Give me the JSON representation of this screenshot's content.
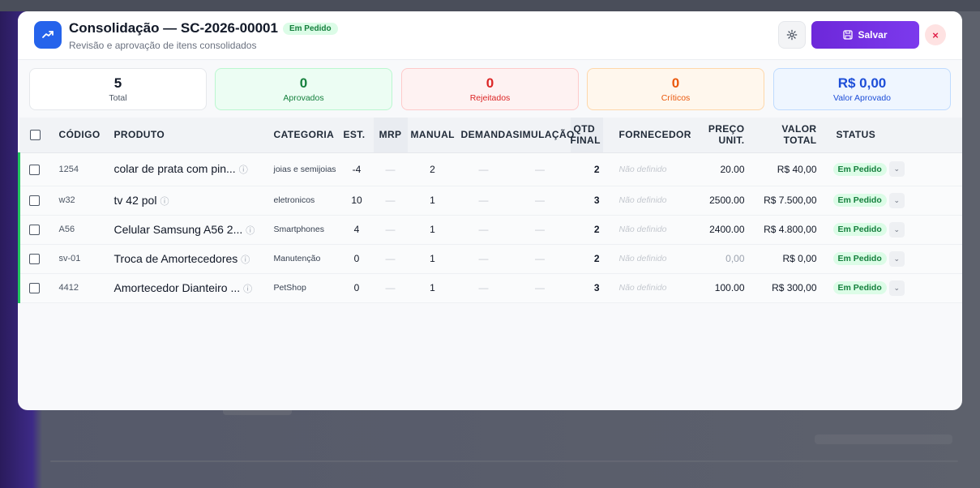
{
  "header": {
    "title": "Consolidação — SC-2026-00001",
    "status": "Em Pedido",
    "subtitle": "Revisão e aprovação de itens consolidados",
    "save_label": "Salvar",
    "close_label": "×"
  },
  "cards": [
    {
      "value": "5",
      "label": "Total"
    },
    {
      "value": "0",
      "label": "Aprovados"
    },
    {
      "value": "0",
      "label": "Rejeitados"
    },
    {
      "value": "0",
      "label": "Críticos"
    },
    {
      "value": "R$ 0,00",
      "label": "Valor Aprovado"
    }
  ],
  "columns": {
    "codigo": "CÓDIGO",
    "produto": "PRODUTO",
    "categoria": "CATEGORIA",
    "est": "EST.",
    "mrp": "MRP",
    "manual": "MANUAL",
    "demanda": "DEMANDA",
    "simulacao": "SIMULAÇÃO",
    "qtd_final_1": "QTD",
    "qtd_final_2": "FINAL",
    "fornecedor": "FORNECEDOR",
    "preco_1": "PREÇO",
    "preco_2": "UNIT.",
    "valor_1": "VALOR",
    "valor_2": "TOTAL",
    "status": "STATUS"
  },
  "rows": [
    {
      "codigo": "1254",
      "produto": "colar de prata com pin...",
      "categoria": "joias e semijoias",
      "est": "-4",
      "mrp": "—",
      "manual": "2",
      "demanda": "—",
      "simulacao": "—",
      "qtd_final": "2",
      "fornecedor": "Não definido",
      "preco": "20.00",
      "valor": "R$ 40,00",
      "status": "Em Pedido"
    },
    {
      "codigo": "w32",
      "produto": "tv 42 pol",
      "categoria": "eletronicos",
      "est": "10",
      "mrp": "—",
      "manual": "1",
      "demanda": "—",
      "simulacao": "—",
      "qtd_final": "3",
      "fornecedor": "Não definido",
      "preco": "2500.00",
      "valor": "R$ 7.500,00",
      "status": "Em Pedido"
    },
    {
      "codigo": "A56",
      "produto": "Celular Samsung A56 2...",
      "categoria": "Smartphones",
      "est": "4",
      "mrp": "—",
      "manual": "1",
      "demanda": "—",
      "simulacao": "—",
      "qtd_final": "2",
      "fornecedor": "Não definido",
      "preco": "2400.00",
      "valor": "R$ 4.800,00",
      "status": "Em Pedido"
    },
    {
      "codigo": "sv-01",
      "produto": "Troca de Amortecedores",
      "categoria": "Manutenção",
      "est": "0",
      "mrp": "—",
      "manual": "1",
      "demanda": "—",
      "simulacao": "—",
      "qtd_final": "2",
      "fornecedor": "Não definido",
      "preco": "0,00",
      "valor": "R$ 0,00",
      "status": "Em Pedido"
    },
    {
      "codigo": "4412",
      "produto": "Amortecedor Dianteiro ...",
      "categoria": "PetShop",
      "est": "0",
      "mrp": "—",
      "manual": "1",
      "demanda": "—",
      "simulacao": "—",
      "qtd_final": "3",
      "fornecedor": "Não definido",
      "preco": "100.00",
      "valor": "R$ 300,00",
      "status": "Em Pedido"
    }
  ],
  "colors": {
    "accent": "#7c3aed",
    "brand_icon": "#2563eb",
    "approved": "#15803d",
    "rejected": "#dc2626",
    "critical": "#ea580c",
    "value": "#1d4ed8"
  }
}
